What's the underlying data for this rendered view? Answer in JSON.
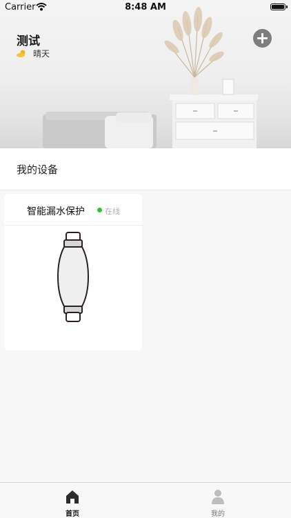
{
  "status_bar": {
    "carrier": "Carrier",
    "time": "8:48 AM"
  },
  "header": {
    "home_name": "测试",
    "weather": {
      "icon": "partly-sunny-icon",
      "text": "晴天"
    },
    "add_icon": "plus-circle-icon"
  },
  "section": {
    "title": "我的设备"
  },
  "devices": [
    {
      "name": "智能漏水保护",
      "status": "在线",
      "status_color": "#22cc22",
      "image": "water-leak-protector-icon"
    }
  ],
  "tabs": [
    {
      "label": "首页",
      "icon": "home-icon",
      "active": true
    },
    {
      "label": "我的",
      "icon": "user-icon",
      "active": false
    }
  ]
}
